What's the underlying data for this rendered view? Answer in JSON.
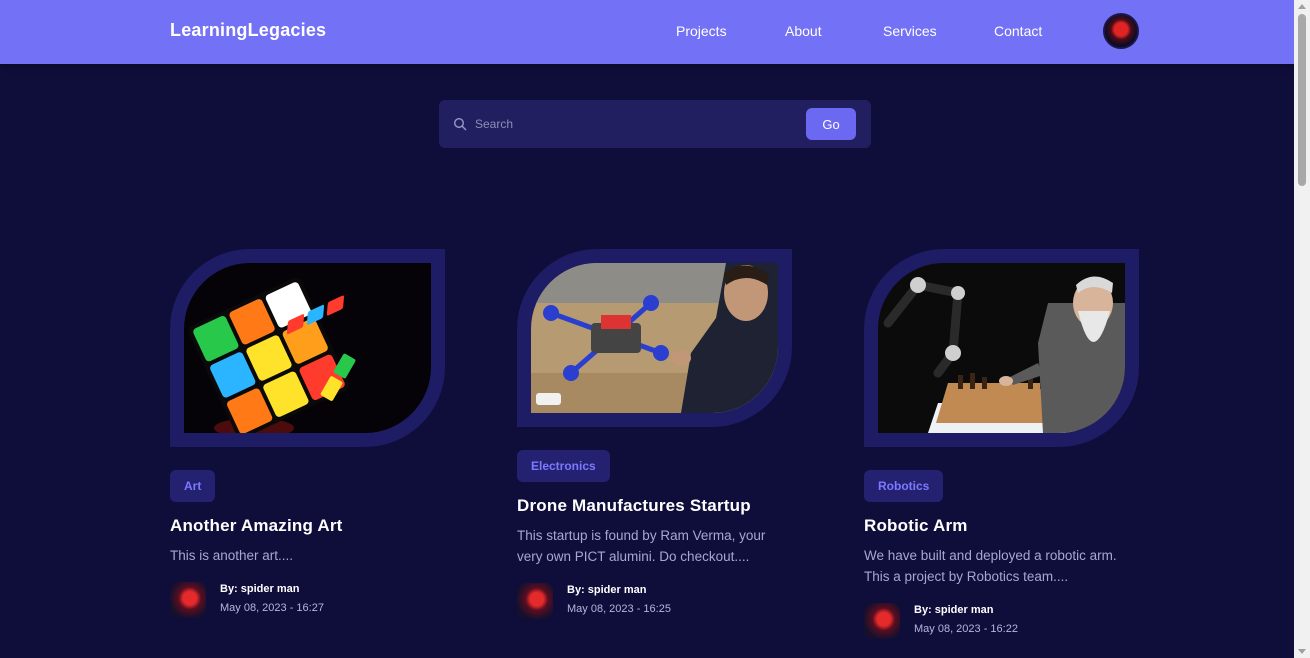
{
  "navbar": {
    "brand": "LearningLegacies",
    "links": [
      "Projects",
      "About",
      "Services",
      "Contact"
    ],
    "accent_color": "#7371f5"
  },
  "search": {
    "placeholder": "Search",
    "button_label": "Go",
    "icon": "search-icon"
  },
  "cards": [
    {
      "tag": "Art",
      "title": "Another Amazing Art",
      "description": "This is another art....",
      "author": "By: spider man",
      "date": "May 08, 2023 - 16:27",
      "image": "rubiks-cube-photo"
    },
    {
      "tag": "Electronics",
      "title": "Drone Manufactures Startup",
      "description": "This startup is found by Ram Verma, your very own PICT alumini. Do checkout....",
      "author": "By: spider man",
      "date": "May 08, 2023 - 16:25",
      "image": "drone-building-photo"
    },
    {
      "tag": "Robotics",
      "title": "Robotic Arm",
      "description": "We have built and deployed a robotic arm. This a project by Robotics team....",
      "author": "By: spider man",
      "date": "May 08, 2023 - 16:22",
      "image": "robot-chess-photo"
    }
  ]
}
